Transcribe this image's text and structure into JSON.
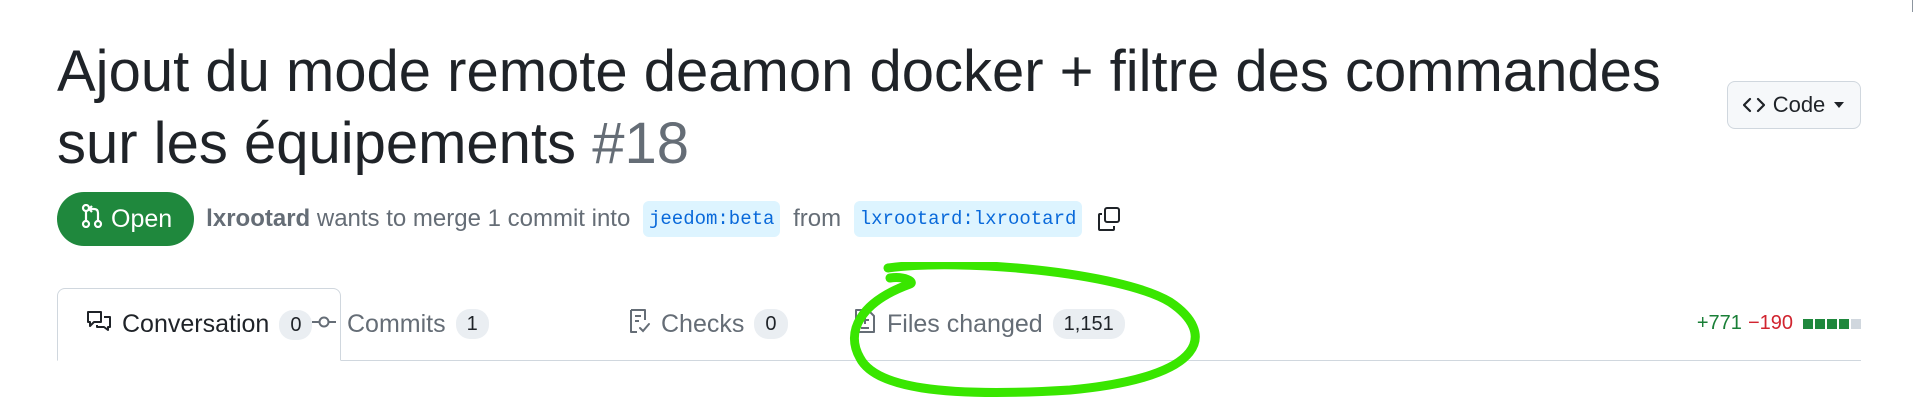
{
  "pr": {
    "title_line1": "Ajout du mode remote deamon docker + filtre des commandes",
    "title_line2": "sur les équipements",
    "number": "#18",
    "state": "Open",
    "author": "lxrootard",
    "action_text": " wants to merge 1 commit into ",
    "base_branch": "jeedom:beta",
    "from_text": " from ",
    "head_branch": "lxrootard:lxrootard"
  },
  "code_button": {
    "label": "Code"
  },
  "tabs": [
    {
      "label": "Conversation",
      "count": "0",
      "icon": "comment-discussion-icon"
    },
    {
      "label": "Commits",
      "count": "1",
      "icon": "git-commit-icon"
    },
    {
      "label": "Checks",
      "count": "0",
      "icon": "checklist-icon"
    },
    {
      "label": "Files changed",
      "count": "1,151",
      "icon": "file-diff-icon"
    }
  ],
  "diffstat": {
    "additions": "+771",
    "deletions": "−190",
    "blocks": [
      "green",
      "green",
      "green",
      "green",
      "gray"
    ]
  },
  "colors": {
    "open_badge": "#1f883d",
    "additions": "#1a7f37",
    "deletions": "#d1242f",
    "branch_text": "#0969da",
    "branch_bg": "#ddf4ff",
    "annotation": "#39e600"
  }
}
